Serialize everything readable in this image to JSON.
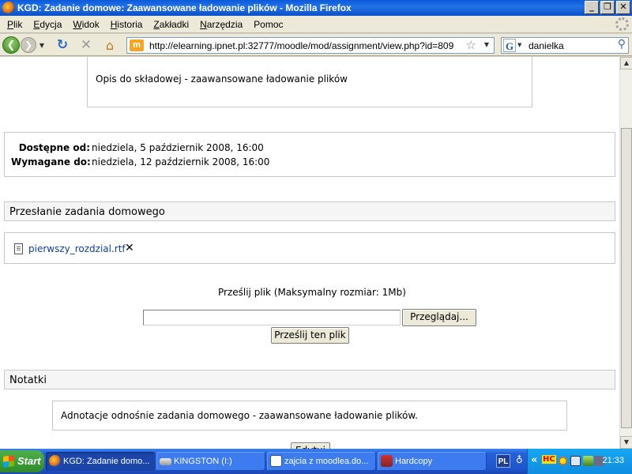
{
  "window": {
    "title": "KGD: Zadanie domowe: Zaawansowane ładowanie plików - Mozilla Firefox",
    "minimize": "_",
    "maximize": "❐",
    "close": "✕"
  },
  "menu": {
    "items": [
      {
        "accel": "P",
        "rest": "lik"
      },
      {
        "accel": "E",
        "rest": "dycja"
      },
      {
        "accel": "W",
        "rest": "idok"
      },
      {
        "accel": "H",
        "rest": "istoria"
      },
      {
        "accel": "Z",
        "rest": "akładki"
      },
      {
        "accel": "N",
        "rest": "arzędzia"
      },
      {
        "accel": "",
        "rest": "Pomoc"
      }
    ]
  },
  "nav": {
    "url": "http://elearning.ipnet.pl:32777/moodle/mod/assignment/view.php?id=809",
    "search_value": "danielka",
    "site_icon": "m"
  },
  "page": {
    "description": "Opis do składowej - zaawansowane ładowanie plików",
    "available_label": "Dostępne od:",
    "available_value": "niedziela, 5 październik 2008, 16:00",
    "due_label": "Wymagane do:",
    "due_value": "niedziela, 12 październik 2008, 16:00",
    "upload_heading": "Przesłanie zadania domowego",
    "file_name": "pierwszy_rozdzial.rtf",
    "upload_caption": "Prześlij plik (Maksymalny rozmiar: 1Mb)",
    "browse_label": "Przeglądaj...",
    "upload_button": "Prześlij ten plik",
    "notes_heading": "Notatki",
    "notes_text": "Adnotacje odnośnie zadania domowego - zaawansowane ładowanie plików.",
    "edit_button": "Edytuj"
  },
  "taskbar": {
    "start": "Start",
    "tasks": [
      {
        "label": "KGD: Zadanie domo...",
        "active": true
      },
      {
        "label": "KINGSTON (I:)",
        "active": false
      },
      {
        "label": "zajcia z moodlea.do...",
        "active": false
      },
      {
        "label": "Hardcopy",
        "active": false
      }
    ],
    "lang": "PL",
    "tray_chevron": "«",
    "tray_hc": "HC",
    "clock": "21:33"
  },
  "colors": {
    "link": "#1040a0",
    "titlebar": "#0a5ad9",
    "taskbar": "#2560d8"
  }
}
